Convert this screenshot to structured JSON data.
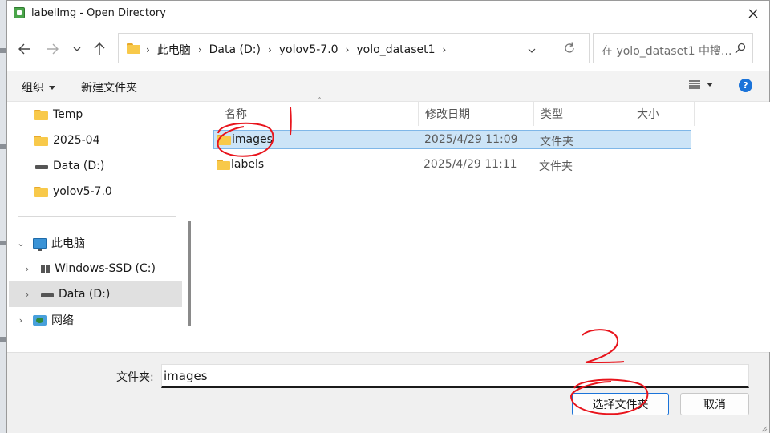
{
  "window": {
    "title": "labelImg - Open Directory"
  },
  "address": {
    "crumbs": [
      "此电脑",
      "Data (D:)",
      "yolov5-7.0",
      "yolo_dataset1"
    ]
  },
  "search": {
    "placeholder": "在 yolo_dataset1 中搜..."
  },
  "toolbar": {
    "organize_label": "组织",
    "new_folder_label": "新建文件夹"
  },
  "navpane": {
    "quick_items": [
      "Temp",
      "2025-04",
      "Data (D:)",
      "yolov5-7.0"
    ],
    "this_pc": "此电脑",
    "drives": [
      "Windows-SSD (C:)",
      "Data (D:)"
    ],
    "network": "网络"
  },
  "files": {
    "columns": [
      "名称",
      "修改日期",
      "类型",
      "大小"
    ],
    "rows": [
      {
        "name": "images",
        "date": "2025/4/29 11:09",
        "type": "文件夹",
        "selected": true
      },
      {
        "name": "labels",
        "date": "2025/4/29 11:11",
        "type": "文件夹",
        "selected": false
      }
    ]
  },
  "bottom": {
    "folder_label": "文件夹:",
    "folder_value": "images",
    "select_label": "选择文件夹",
    "cancel_label": "取消"
  },
  "annotations": {
    "marks": [
      "1",
      "2"
    ],
    "color": "#e8141c"
  },
  "colors": {
    "selection": "#cce4f7",
    "accent": "#1a73d9",
    "folder": "#f8c94a"
  }
}
